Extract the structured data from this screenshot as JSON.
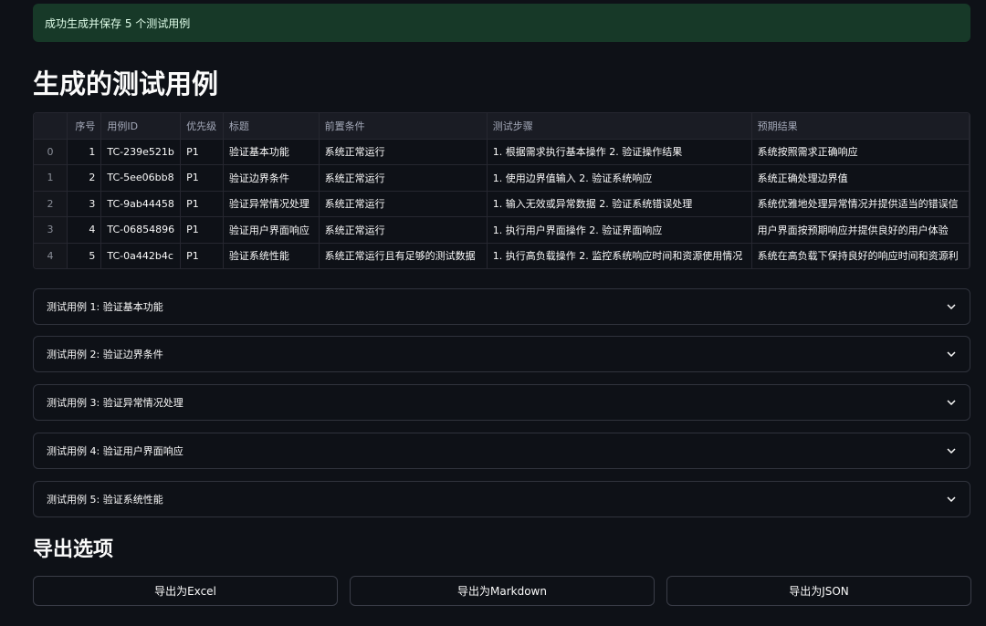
{
  "success_message": "成功生成并保存 5 个测试用例",
  "section_title": "生成的测试用例",
  "table": {
    "columns": [
      "",
      "序号",
      "用例ID",
      "优先级",
      "标题",
      "前置条件",
      "测试步骤",
      "预期结果"
    ],
    "rows": [
      [
        "0",
        "1",
        "TC-239e521b",
        "P1",
        "验证基本功能",
        "系统正常运行",
        "1. 根据需求执行基本操作 2. 验证操作结果",
        "系统按照需求正确响应"
      ],
      [
        "1",
        "2",
        "TC-5ee06bb8",
        "P1",
        "验证边界条件",
        "系统正常运行",
        "1. 使用边界值输入 2. 验证系统响应",
        "系统正确处理边界值"
      ],
      [
        "2",
        "3",
        "TC-9ab44458",
        "P1",
        "验证异常情况处理",
        "系统正常运行",
        "1. 输入无效或异常数据 2. 验证系统错误处理",
        "系统优雅地处理异常情况并提供适当的错误信"
      ],
      [
        "3",
        "4",
        "TC-06854896",
        "P1",
        "验证用户界面响应",
        "系统正常运行",
        "1. 执行用户界面操作 2. 验证界面响应",
        "用户界面按预期响应并提供良好的用户体验"
      ],
      [
        "4",
        "5",
        "TC-0a442b4c",
        "P1",
        "验证系统性能",
        "系统正常运行且有足够的测试数据",
        "1. 执行高负载操作 2. 监控系统响应时间和资源使用情况",
        "系统在高负载下保持良好的响应时间和资源利"
      ]
    ]
  },
  "expanders": [
    "测试用例 1: 验证基本功能",
    "测试用例 2: 验证边界条件",
    "测试用例 3: 验证异常情况处理",
    "测试用例 4: 验证用户界面响应",
    "测试用例 5: 验证系统性能"
  ],
  "export": {
    "title": "导出选项",
    "buttons": [
      "导出为Excel",
      "导出为Markdown",
      "导出为JSON"
    ]
  },
  "icons": {
    "expander_toggle": "chevron-down-icon"
  },
  "colors": {
    "background": "#0e1117",
    "success_bg": "#173928",
    "success_text": "#dffde9"
  }
}
